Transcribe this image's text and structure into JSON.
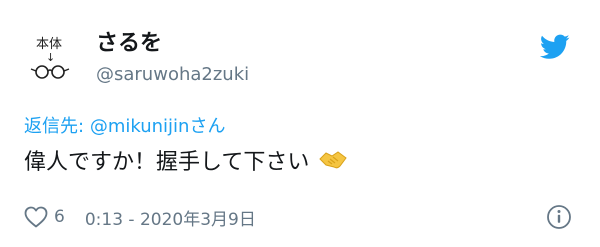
{
  "tweet": {
    "display_name": "さるを",
    "handle": "@saruwoha2zuki",
    "reply_prefix": "返信先:",
    "reply_mention": "@mikunijinさん",
    "text": "偉人ですか！握手して下さい",
    "like_count": "6",
    "timestamp": "0:13 - 2020年3月9日",
    "avatar_text_top": "本体",
    "avatar_text_arrow": "↓"
  },
  "icons": {
    "brand": "twitter-bird-icon",
    "like": "heart-outline-icon",
    "info": "info-circle-icon",
    "emoji": "handshake-emoji"
  },
  "colors": {
    "accent": "#1da1f2",
    "secondary_text": "#657786",
    "primary_text": "#14171a",
    "emoji": "#f5c542"
  }
}
